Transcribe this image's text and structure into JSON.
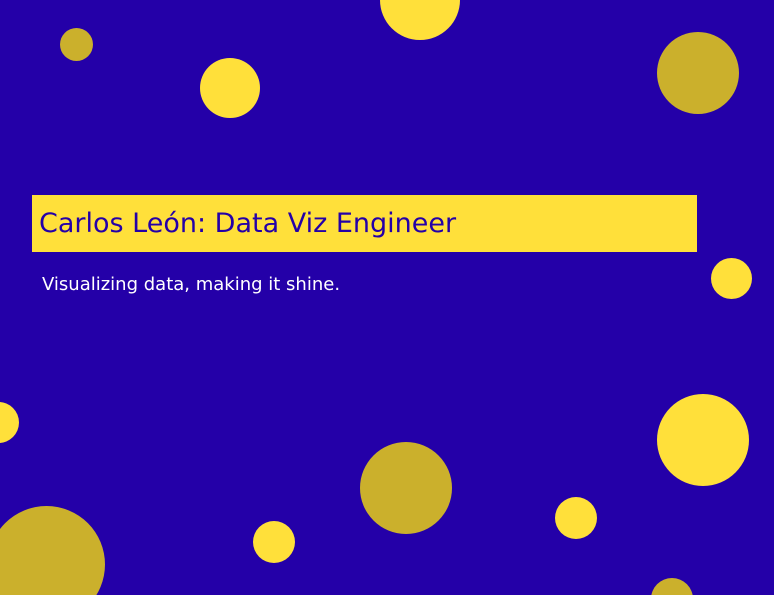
{
  "colors": {
    "background": "#2400A8",
    "bright_yellow": "#FFE03A",
    "mustard": "#CBB02C",
    "title_text": "#2400A8",
    "subtitle_text": "#FFFFFF"
  },
  "title": "Carlos León: Data Viz Engineer",
  "subtitle": "Visualizing data, making it shine."
}
